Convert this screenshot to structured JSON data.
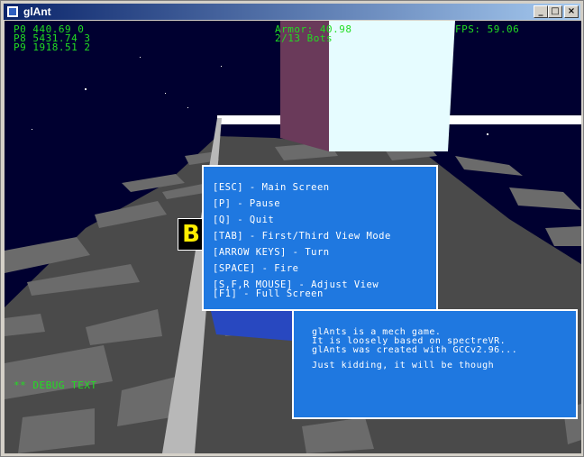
{
  "window": {
    "title": "glAnt",
    "controls": {
      "minimize": "_",
      "maximize": "□",
      "close": "×"
    }
  },
  "hud": {
    "players": [
      "P0 440.69 0",
      "P8 5431.74 3",
      "P9 1918.51 2"
    ],
    "armor": "Armor: 40.98",
    "bots": "2/13 Bots",
    "fps": "FPS: 59.06",
    "debug": "** DEBUG TEXT",
    "text_color": "#22dd22"
  },
  "marker": {
    "label": "B"
  },
  "help_menu": {
    "items": [
      "[ESC] - Main Screen",
      "[P] - Pause",
      "[Q] - Quit",
      "[TAB] - First/Third View Mode",
      "[ARROW KEYS] - Turn",
      "[SPACE] - Fire",
      "[S,F,R MOUSE] - Adjust View",
      "[F1] - Full Screen"
    ]
  },
  "info_panel": {
    "lines": [
      "glAnts is a mech game.",
      "It is loosely based on spectreVR.",
      "glAnts was created with GCCv2.96...",
      "Just kidding, it will be though"
    ]
  },
  "colors": {
    "sky": "#000030",
    "panel": "#1f78e0",
    "ground": "#5a5a5a",
    "tile": "#6b6b6b",
    "block_purple": "#6a3a5a",
    "block_light": "#e6fcff"
  }
}
